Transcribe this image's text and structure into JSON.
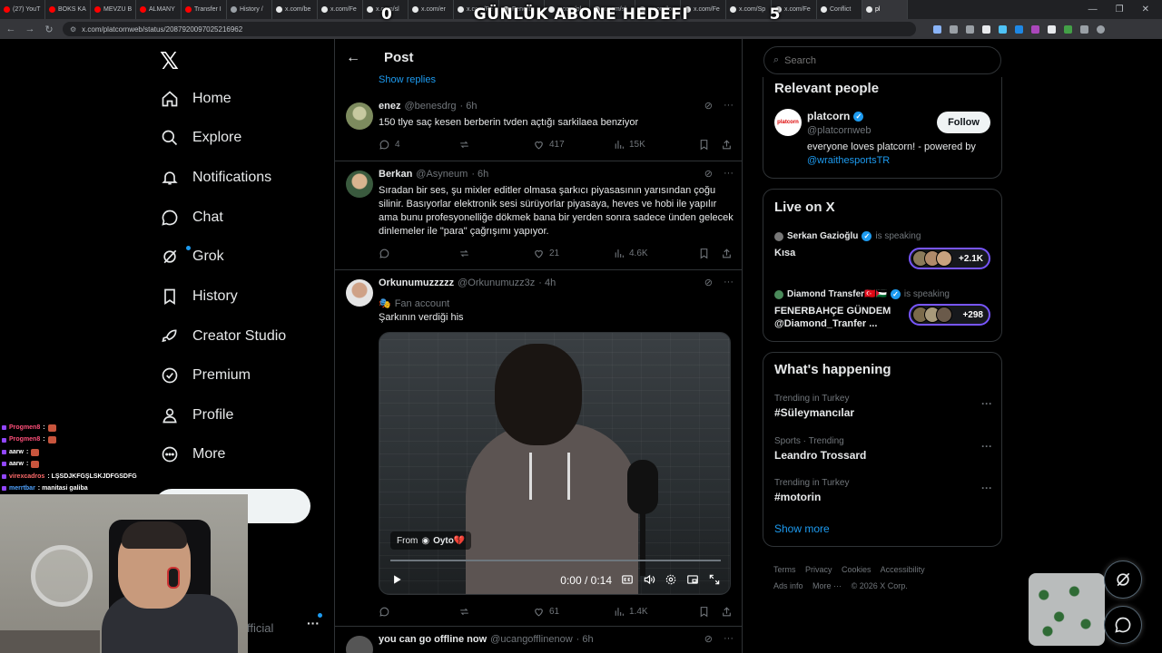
{
  "browser": {
    "tabs": [
      {
        "label": "(27) YouT",
        "color": "#ff0000"
      },
      {
        "label": "BOKS KA",
        "color": "#ff0000"
      },
      {
        "label": "MEVZU B",
        "color": "#ff0000"
      },
      {
        "label": "ALMANY",
        "color": "#ff0000"
      },
      {
        "label": "Transfer I",
        "color": "#ff0000"
      },
      {
        "label": "History /",
        "color": "#9aa0a6"
      },
      {
        "label": "x.com/be",
        "color": "#e7e9ea"
      },
      {
        "label": "x.com/Fe",
        "color": "#e7e9ea"
      },
      {
        "label": "x.com/sl",
        "color": "#e7e9ea"
      },
      {
        "label": "x.com/er",
        "color": "#e7e9ea"
      },
      {
        "label": "x.com/Fe",
        "color": "#e7e9ea"
      },
      {
        "label": "Fenerb",
        "color": "#e7e9ea"
      },
      {
        "label": "x.com/pl",
        "color": "#e7e9ea"
      },
      {
        "label": "x.com/sl",
        "color": "#e7e9ea"
      },
      {
        "label": "x.com/lo",
        "color": "#e7e9ea"
      },
      {
        "label": "x.com/Fe",
        "color": "#e7e9ea"
      },
      {
        "label": "x.com/Sp",
        "color": "#e7e9ea"
      },
      {
        "label": "x.com/Fe",
        "color": "#e7e9ea"
      },
      {
        "label": "Conflict",
        "color": "#e7e9ea"
      },
      {
        "label": "pl",
        "color": "#e7e9ea",
        "active": true
      }
    ],
    "url": "x.com/platcornweb/status/2087920097025216962"
  },
  "overlay": {
    "left_count": "0",
    "title": "GÜNLÜK ABONE HEDEFI",
    "right_count": "5"
  },
  "nav": {
    "items": [
      {
        "label": "Home",
        "icon": "home-icon"
      },
      {
        "label": "Explore",
        "icon": "search-icon"
      },
      {
        "label": "Notifications",
        "icon": "bell-icon"
      },
      {
        "label": "Chat",
        "icon": "chat-icon"
      },
      {
        "label": "Grok",
        "icon": "grok-icon"
      },
      {
        "label": "History",
        "icon": "bookmark-icon"
      },
      {
        "label": "Creator Studio",
        "icon": "rocket-icon"
      },
      {
        "label": "Premium",
        "icon": "verified-icon"
      },
      {
        "label": "Profile",
        "icon": "person-icon"
      },
      {
        "label": "More",
        "icon": "more-icon"
      }
    ],
    "account_tail": "fficial"
  },
  "center": {
    "title": "Post",
    "show_replies": "Show replies",
    "tweets": [
      {
        "name": "enez",
        "handle": "@benesdrg",
        "time": "· 6h",
        "text": "150 tlye saç kesen berberin tvden açtığı sarkilaea benziyor",
        "replies": "4",
        "reposts": "",
        "likes": "417",
        "views": "15K"
      },
      {
        "name": "Berkan",
        "handle": "@Asyneum",
        "time": "· 6h",
        "text": "Sıradan bir ses, şu mixler editler olmasa şarkıcı piyasasının yarısından çoğu silinir. Basıyorlar elektronik sesi sürüyorlar piyasaya, heves ve hobi ile yapılır ama bunu profesyonelliğe dökmek bana bir yerden sonra sadece ünden gelecek dinlemeler ile \"para\" çağrışımı yapıyor.",
        "replies": "",
        "reposts": "",
        "likes": "21",
        "views": "4.6K"
      },
      {
        "name": "Orkunumuzzzzz",
        "handle": "@Orkunumuzz3z",
        "time": "· 4h",
        "badge": "Fan account",
        "text": "Şarkının verdiği his",
        "video_from": "From",
        "video_source": "Oyto💔",
        "video_time": "0:00 / 0:14",
        "replies": "",
        "reposts": "",
        "likes": "61",
        "views": "1.4K"
      },
      {
        "name": "you can go offline now",
        "handle": "@ucangofflinenow",
        "time": "· 6h"
      }
    ]
  },
  "right": {
    "search_placeholder": "Search",
    "relevant": {
      "title": "Relevant people",
      "name": "platcorn",
      "handle": "@platcornweb",
      "bio": "everyone loves platcorn! - powered by",
      "bio_link": "@wraithesportsTR",
      "follow": "Follow",
      "avatar_text": "platcorn"
    },
    "live": {
      "title": "Live on X",
      "items": [
        {
          "host": "Serkan Gazioğlu",
          "status": "is speaking",
          "title": "Kısa",
          "count": "+2.1K"
        },
        {
          "host": "Diamond Transfer🇹🇷🇵🇸",
          "status": "is speaking",
          "title": "FENERBAHÇE GÜNDEM @Diamond_Tranfer ...",
          "count": "+298"
        }
      ]
    },
    "happening": {
      "title": "What's happening",
      "trends": [
        {
          "meta": "Trending in Turkey",
          "topic": "#Süleymancılar"
        },
        {
          "meta": "Sports · Trending",
          "topic": "Leandro Trossard"
        },
        {
          "meta": "Trending in Turkey",
          "topic": "#motorin"
        }
      ],
      "show_more": "Show more"
    },
    "footer": [
      "Terms",
      "Privacy",
      "Cookies",
      "Accessibility",
      "Ads info",
      "More ···",
      "© 2026 X Corp."
    ]
  },
  "chat": [
    {
      "user": "Progmen8",
      "color": "#ff4f7a",
      "msg": ":"
    },
    {
      "user": "Progmen8",
      "color": "#ff4f7a",
      "msg": ":"
    },
    {
      "user": "aarw",
      "color": "#ffffff",
      "msg": ":"
    },
    {
      "user": "aarw",
      "color": "#ffffff",
      "msg": ":"
    },
    {
      "user": "virexcadros",
      "color": "#ff6b6b",
      "msg": ": LŞSDJKFGŞLSKJDFGSDFG"
    },
    {
      "user": "merrtbar",
      "color": "#4fa3ff",
      "msg": ": manitasi galiba"
    }
  ]
}
